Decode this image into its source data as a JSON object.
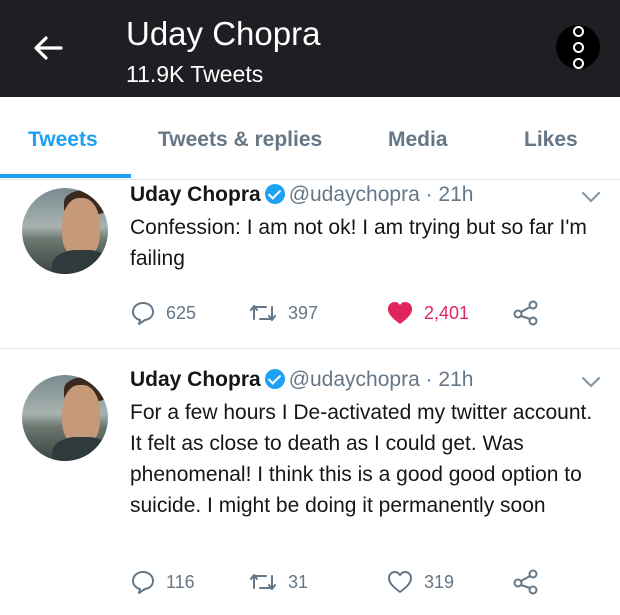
{
  "header": {
    "title": "Uday Chopra",
    "subtitle": "11.9K Tweets"
  },
  "tabs": [
    {
      "label": "Tweets",
      "active": true
    },
    {
      "label": "Tweets & replies",
      "active": false
    },
    {
      "label": "Media",
      "active": false
    },
    {
      "label": "Likes",
      "active": false
    }
  ],
  "tweets": [
    {
      "name": "Uday Chopra",
      "handle": "@udaychopra",
      "time": "· 21h",
      "text": "Confession: I am not ok! I am trying but so far I'm failing",
      "replies": "625",
      "retweets": "397",
      "likes": "2,401",
      "liked": true
    },
    {
      "name": "Uday Chopra",
      "handle": "@udaychopra",
      "time": "· 21h",
      "text": "For a few hours I De-activated my twitter account. It felt as close to death as I could get. Was phenomenal! I think this is a good good option to suicide. I might be doing it permanently soon",
      "replies": "116",
      "retweets": "31",
      "likes": "319",
      "liked": false
    }
  ],
  "colors": {
    "accent": "#1da1f2",
    "like": "#e0245e",
    "header_bg": "#1d1f22",
    "muted": "#657786"
  },
  "icons": [
    "back-arrow-icon",
    "more-options-icon",
    "verified-badge-icon",
    "chevron-down-icon",
    "reply-icon",
    "retweet-icon",
    "like-icon",
    "share-icon"
  ]
}
